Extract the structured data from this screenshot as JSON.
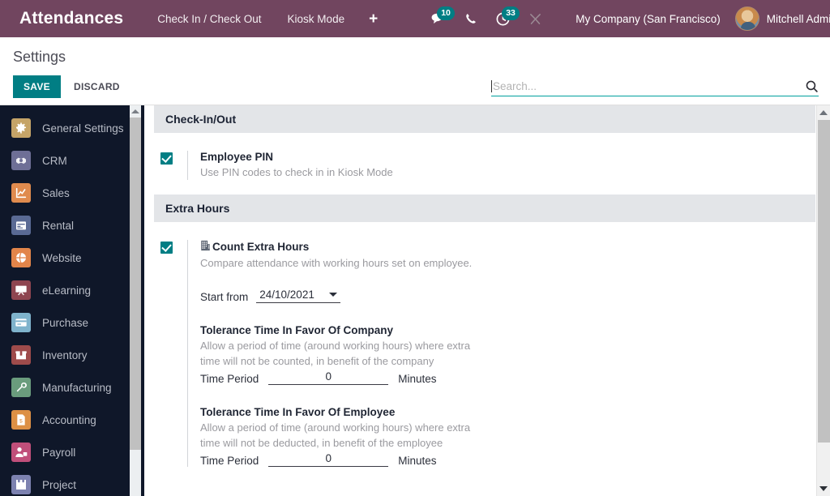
{
  "topbar": {
    "apps_icon": "apps-grid-icon",
    "app_title": "Attendances",
    "menu": [
      {
        "label": "Check In / Check Out"
      },
      {
        "label": "Kiosk Mode"
      }
    ],
    "plus_label": "+",
    "messages": {
      "icon": "chat-bubble-icon",
      "count": "10"
    },
    "phone": {
      "icon": "phone-icon"
    },
    "activities": {
      "icon": "clock-icon",
      "count": "33"
    },
    "debug": {
      "icon": "wrench-icon"
    },
    "company": "My Company (San Francisco)",
    "user": "Mitchell Admin",
    "bg_color": "#71455f",
    "badge_color": "#017e84"
  },
  "control_panel": {
    "title": "Settings",
    "save_label": "SAVE",
    "discard_label": "DISCARD",
    "save_color": "#017e84",
    "search_placeholder": "Search...",
    "search_value": "",
    "search_icon": "magnifier-icon",
    "search_underline_color": "#00a09d"
  },
  "sidebar": {
    "items": [
      {
        "label": "General Settings",
        "icon": "gear-icon",
        "color": "#c5a468"
      },
      {
        "label": "CRM",
        "icon": "handshake-icon",
        "color": "#6e6f96"
      },
      {
        "label": "Sales",
        "icon": "chart-up-icon",
        "color": "#e08b4e"
      },
      {
        "label": "Rental",
        "icon": "calendar-icon",
        "color": "#5a6a94"
      },
      {
        "label": "Website",
        "icon": "globe-icon",
        "color": "#e2854a"
      },
      {
        "label": "eLearning",
        "icon": "presentation-icon",
        "color": "#8e4550"
      },
      {
        "label": "Purchase",
        "icon": "card-icon",
        "color": "#7fb3cc"
      },
      {
        "label": "Inventory",
        "icon": "box-icon",
        "color": "#9e4b4b"
      },
      {
        "label": "Manufacturing",
        "icon": "wrench-icon",
        "color": "#6a9c7d"
      },
      {
        "label": "Accounting",
        "icon": "invoice-icon",
        "color": "#dd9045"
      },
      {
        "label": "Payroll",
        "icon": "person-badge-icon",
        "color": "#c04f7a"
      },
      {
        "label": "Project",
        "icon": "puzzle-icon",
        "color": "#7d82b0"
      }
    ],
    "bg_color": "#0f1729"
  },
  "main": {
    "sections": [
      {
        "title": "Check-In/Out",
        "settings": [
          {
            "checked": true,
            "label": "Employee PIN",
            "description": "Use PIN codes to check in in Kiosk Mode"
          }
        ]
      },
      {
        "title": "Extra Hours",
        "settings": [
          {
            "checked": true,
            "company_icon": "building-icon",
            "label": "Count Extra Hours",
            "description": "Compare attendance with working hours set on employee.",
            "start_from_label": "Start from",
            "start_from_value": "24/10/2021",
            "tolerances": [
              {
                "title": "Tolerance Time In Favor Of Company",
                "description": "Allow a period of time (around working hours) where extra time will not be counted, in benefit of the company",
                "field_label": "Time Period",
                "value": "0",
                "unit": "Minutes"
              },
              {
                "title": "Tolerance Time In Favor Of Employee",
                "description": "Allow a period of time (around working hours) where extra time will not be deducted, in benefit of the employee",
                "field_label": "Time Period",
                "value": "0",
                "unit": "Minutes"
              }
            ]
          }
        ]
      }
    ]
  }
}
